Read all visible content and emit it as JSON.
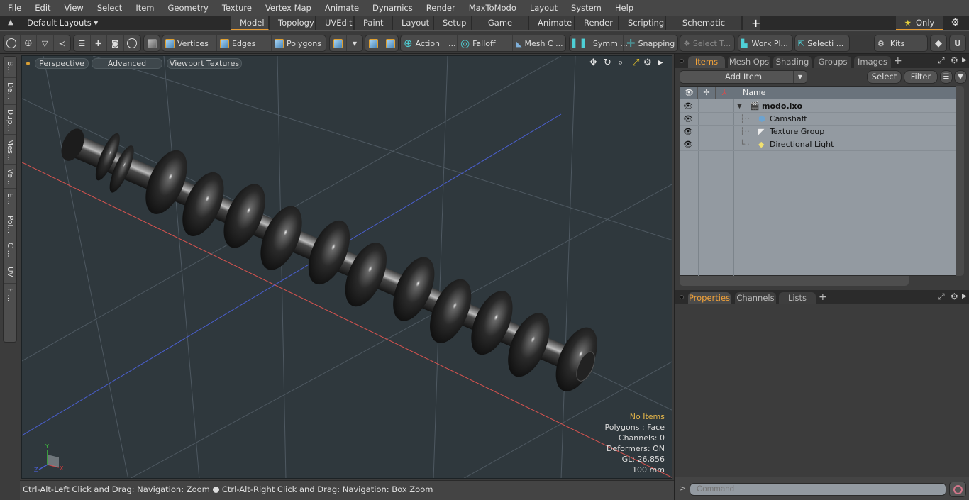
{
  "menu": [
    "File",
    "Edit",
    "View",
    "Select",
    "Item",
    "Geometry",
    "Texture",
    "Vertex Map",
    "Animate",
    "Dynamics",
    "Render",
    "MaxToModo",
    "Layout",
    "System",
    "Help"
  ],
  "layoutbar": {
    "layouts_label": "Default Layouts ▾",
    "tabs": [
      "Model",
      "Topology",
      "UVEdit",
      "Paint",
      "Layout",
      "Setup",
      "Game Tools",
      "Animate",
      "Render",
      "Scripting",
      "Schematic Fusion"
    ],
    "active_tab": "Model",
    "add_tab": "+",
    "only_label": "Only"
  },
  "toolbar": {
    "vertices": "Vertices",
    "edges": "Edges",
    "polygons": "Polygons",
    "action": "Action",
    "falloff": "Falloff",
    "mesh": "Mesh C ...",
    "symmetry": "Symm ...",
    "snapping": "Snapping",
    "select_t": "Select T...",
    "workplane": "Work Pl...",
    "selection": "Selecti ...",
    "kits": "Kits",
    "ellipsis": "..."
  },
  "left_tabs": [
    "B...",
    "De...",
    "Dup...",
    "Mes...",
    "Ve...",
    "E...",
    "Pol...",
    "C ...",
    "UV",
    "F ..."
  ],
  "viewport": {
    "view_mode": "Perspective",
    "shading": "Advanced",
    "textures": "Viewport Textures",
    "info": {
      "selection": "No Items",
      "polygons": "Polygons : Face",
      "channels": "Channels: 0",
      "deformers": "Deformers: ON",
      "gl": "GL: 26,856",
      "scale": "100 mm"
    },
    "axis_labels": {
      "x": "X",
      "y": "Y",
      "z": "Z"
    }
  },
  "status": {
    "hint1": "Ctrl-Alt-Left Click and Drag: Navigation: Zoom",
    "hint2": "Ctrl-Alt-Right Click and Drag: Navigation: Box Zoom"
  },
  "items_panel": {
    "tabs": [
      "Items",
      "Mesh Ops",
      "Shading",
      "Groups",
      "Images"
    ],
    "active_tab": "Items",
    "add_item": "Add Item",
    "select": "Select",
    "filter": "Filter",
    "column_name": "Name",
    "rows": [
      {
        "name": "modo.lxo",
        "icon": "scene-icon",
        "bold": true
      },
      {
        "name": "Camshaft",
        "icon": "mesh-icon"
      },
      {
        "name": "Texture Group",
        "icon": "texture-group-icon"
      },
      {
        "name": "Directional Light",
        "icon": "light-icon"
      }
    ]
  },
  "properties_panel": {
    "tabs": [
      "Properties",
      "Channels",
      "Lists"
    ],
    "active_tab": "Properties"
  },
  "command": {
    "prompt": ">",
    "placeholder": "Command"
  },
  "colors": {
    "accent": "#e79b32",
    "viewport_bg": "#2f383d",
    "tree_bg": "#939aa1",
    "x_axis": "#d9534f",
    "z_axis": "#4a5fd0"
  }
}
